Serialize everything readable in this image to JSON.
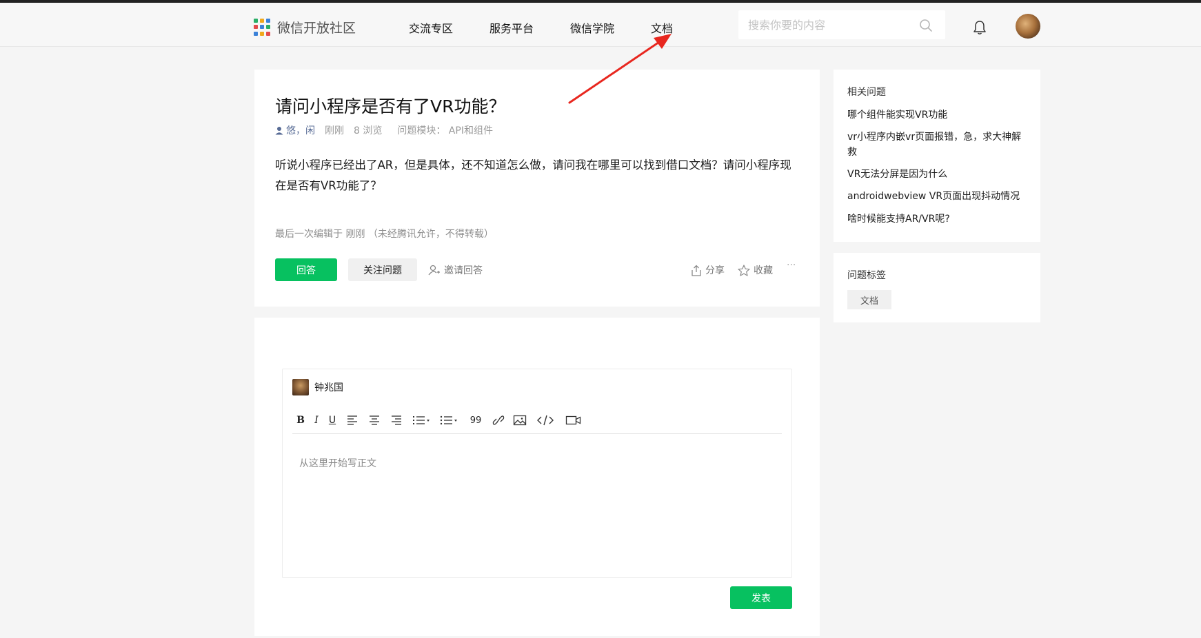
{
  "header": {
    "logo_text": "微信开放社区",
    "nav": [
      "交流专区",
      "服务平台",
      "微信学院",
      "文档"
    ],
    "search_placeholder": "搜索你要的内容"
  },
  "question": {
    "title": "请问小程序是否有了VR功能？",
    "author": "悠，闲",
    "time": "刚刚",
    "views": "8 浏览",
    "module": "问题模块：  API和组件",
    "body": "听说小程序已经出了AR，但是具体，还不知道怎么做，请问我在哪里可以找到借口文档？请问小程序现在是否有VR功能了？",
    "edited": "最后一次编辑于  刚刚   （未经腾讯允许，不得转载）",
    "answer_btn": "回答",
    "follow_btn": "关注问题",
    "invite": "邀请回答",
    "share": "分享",
    "favorite": "收藏",
    "more": "···"
  },
  "editor": {
    "username": "钟兆国",
    "toolbar": {
      "bold": "B",
      "italic": "I",
      "underline": "U",
      "quote": "99"
    },
    "placeholder": "从这里开始写正文",
    "submit": "发表"
  },
  "sidebar": {
    "related_title": "相关问题",
    "related": [
      "哪个组件能实现VR功能",
      "vr小程序内嵌vr页面报错，急，求大神解救",
      "VR无法分屏是因为什么",
      "androidwebview VR页面出现抖动情况",
      "啥时候能支持AR/VR呢?"
    ],
    "tags_title": "问题标签",
    "tags": [
      "文档"
    ]
  },
  "colors": {
    "accent": "#07c160",
    "author": "#576b95",
    "annotation_arrow": "#e8271f"
  }
}
